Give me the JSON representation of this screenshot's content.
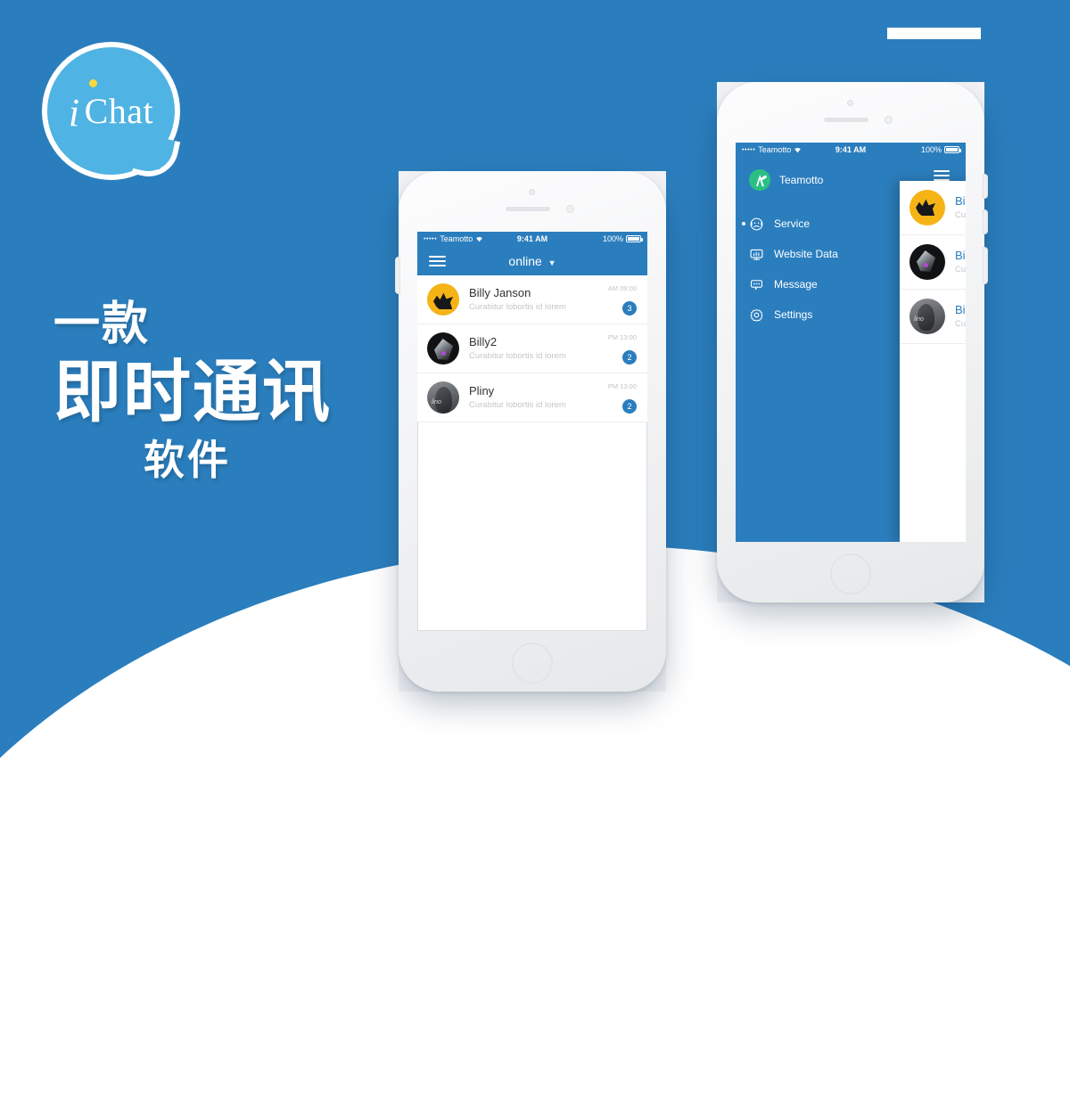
{
  "theme": {
    "brand_blue": "#2b7ebd",
    "logo_blue": "#4fb3e3",
    "logo_dot_yellow": "#ffd83b",
    "accent_green": "#2bbf84",
    "white": "#ffffff"
  },
  "logo": {
    "mark_i": "i",
    "mark_chat": "Chat",
    "icon": "speech-bubble"
  },
  "tagline": {
    "line1": "一款",
    "line2": "即时通讯",
    "line3": "软件"
  },
  "phone1": {
    "status_bar": {
      "signal_dots": "•••••",
      "carrier": "Teamotto",
      "wifi_icon": "wifi-icon",
      "time": "9:41 AM",
      "battery_percent": "100%",
      "battery_icon": "battery-full-icon"
    },
    "nav": {
      "menu_icon": "hamburger-icon",
      "title": "online",
      "caret": "▼"
    },
    "chats": [
      {
        "name": "Billy Janson",
        "preview": "Curabitur lobortis id lorem",
        "time": "AM 09:00",
        "unread": "3",
        "avatar": "billy-janson-avatar"
      },
      {
        "name": "Billy2",
        "preview": "Curabitur lobortis id lorem",
        "time": "PM 13:00",
        "unread": "2",
        "avatar": "billy2-avatar"
      },
      {
        "name": "Pliny",
        "preview": "Curabitur lobortis id lorem",
        "time": "PM 13:00",
        "unread": "2",
        "avatar": "pliny-avatar"
      }
    ]
  },
  "phone2": {
    "status_bar": {
      "signal_dots": "•••••",
      "carrier": "Teamotto",
      "wifi_icon": "wifi-icon",
      "time": "9:41 AM",
      "battery_percent": "100%",
      "battery_icon": "battery-full-icon"
    },
    "drawer": {
      "brand_name": "Teamotto",
      "brand_avatar": "teamotto-logo-icon",
      "menu_icon": "hamburger-icon",
      "items": [
        {
          "label": "Service",
          "icon": "headset-icon",
          "active": true
        },
        {
          "label": "Website Data",
          "icon": "monitor-chart-icon",
          "active": false
        },
        {
          "label": "Message",
          "icon": "chat-bubble-icon",
          "active": false
        },
        {
          "label": "Settings",
          "icon": "gear-icon",
          "active": false
        }
      ]
    },
    "chats": [
      {
        "name": "Bil",
        "preview": "Cur",
        "avatar": "billy-janson-avatar"
      },
      {
        "name": "Bil",
        "preview": "Cur",
        "avatar": "billy2-avatar"
      },
      {
        "name": "Bil",
        "preview": "Cur",
        "avatar": "pliny-avatar"
      }
    ]
  },
  "decor": {
    "top_bar": "white-rectangle-decoration",
    "bottom_wave": "white-curve-decoration"
  }
}
